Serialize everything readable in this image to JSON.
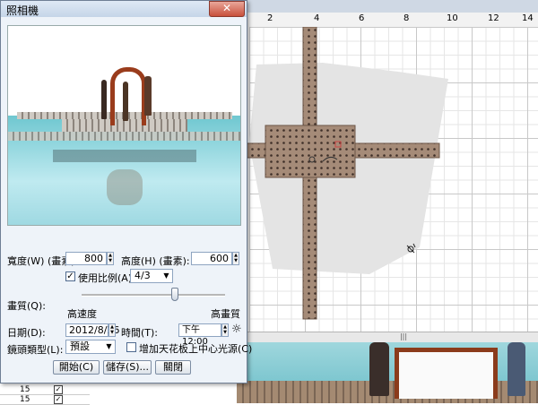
{
  "dialog": {
    "title": "照相機",
    "close_symbol": "✕",
    "width_label": "寬度(W) (畫素):",
    "width_value": "800",
    "height_label": "高度(H) (畫素):",
    "height_value": "600",
    "use_ratio_label": "使用比例(A):",
    "use_ratio_checked": true,
    "ratio_value": "4/3",
    "quality_label": "畫質(Q):",
    "quality_low": "高速度",
    "quality_high": "高畫質",
    "quality_level": 0.65,
    "date_label": "日期(D):",
    "date_value": "2012/8/16",
    "time_label": "時間(T):",
    "time_value": "下午 12:00",
    "lens_label": "鏡頭類型(L):",
    "lens_value": "預設",
    "ceiling_light_label": "增加天花板上中心光源(C)",
    "ceiling_light_checked": false,
    "start_button": "開始(C)",
    "save_button": "儲存(S)...",
    "close_button": "關閉"
  },
  "ruler": {
    "marks": [
      "2",
      "4",
      "6",
      "8",
      "10",
      "12",
      "14"
    ]
  },
  "list": {
    "rows": [
      {
        "num": "15",
        "checked": true
      },
      {
        "num": "15",
        "checked": true
      }
    ]
  },
  "icons": {
    "sun": "sun-icon",
    "check": "checkmark-icon",
    "dropdown": "chevron-down-icon"
  }
}
